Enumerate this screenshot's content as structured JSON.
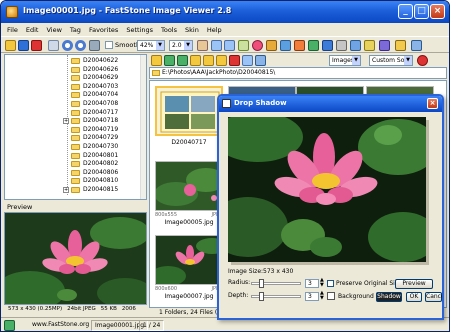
{
  "window": {
    "title": "Image00001.jpg - FastStone Image Viewer 2.8"
  },
  "menu": [
    "File",
    "Edit",
    "View",
    "Tag",
    "Favorites",
    "Settings",
    "Tools",
    "Skin",
    "Help"
  ],
  "toolbar": {
    "smooth_label": "Smooth",
    "zoom_value": "42%",
    "ratio_value": "2.0"
  },
  "tree": {
    "folders": [
      "D20040622",
      "D20040626",
      "D20040629",
      "D20040703",
      "D20040704",
      "D20040708",
      "D20040717",
      "D20040718",
      "D20040719",
      "D20040729",
      "D20040730",
      "D20040801",
      "D20040802",
      "D20040806",
      "D20040810",
      "D20040815"
    ]
  },
  "preview": {
    "header": "Preview",
    "status": [
      "573 x 430 (0.25MP)",
      "24bit JPEG",
      "55 KB",
      "2006"
    ]
  },
  "browser": {
    "address": "E:\\Photos\\AAA\\JackPhoto\\D20040815\\",
    "filter": "Images",
    "sort": "Custom Sort",
    "thumbs": [
      {
        "name": "D20040717",
        "meta_left": "",
        "meta_right": ""
      },
      {
        "name": "Image00005.jpg",
        "meta_left": "800x555",
        "meta_right": "JPEG"
      },
      {
        "name": "Image00007.jpg",
        "meta_left": "800x600",
        "meta_right": "JPEG"
      }
    ],
    "status": "1 Folders, 24 Files (9"
  },
  "bottom_status": {
    "site": "www.FastStone.org",
    "file": "Image00001.jpg",
    "page": "1 / 24"
  },
  "dialog": {
    "title": "Drop Shadow",
    "image_size": "Image Size:573 x 430",
    "radius_label": "Radius:",
    "radius_value": "3",
    "depth_label": "Depth:",
    "depth_value": "3",
    "preserve_label": "Preserve Original Size",
    "preview_button": "Preview",
    "background_label": "Background",
    "shadow_label": "Shadow",
    "ok_button": "OK",
    "cancel_button": "Cancel"
  },
  "colors": {
    "titlebar": "#1c5fd8",
    "chrome": "#ece9d8",
    "selection": "#f6c341",
    "lotus_pink": "#e8609a"
  }
}
